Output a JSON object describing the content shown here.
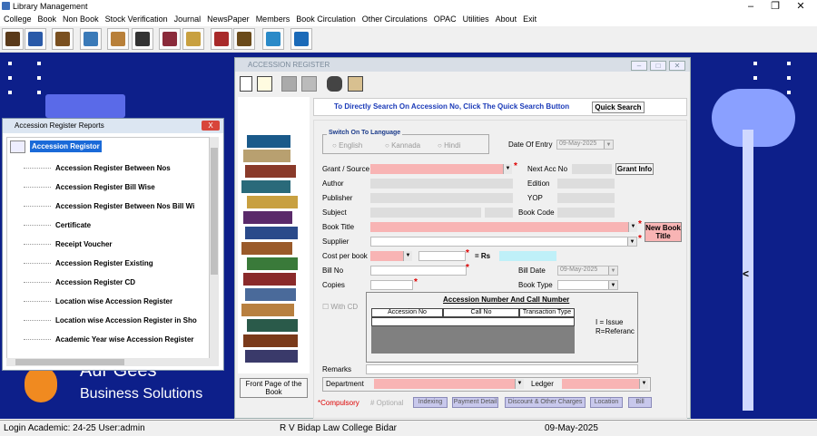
{
  "app_title": "Library Management",
  "menu": [
    "College",
    "Book",
    "Non Book",
    "Stock Verification",
    "Journal",
    "NewsPaper",
    "Members",
    "Book Circulation",
    "Other Circulations",
    "OPAC",
    "Utilities",
    "About",
    "Exit"
  ],
  "toolbar_icons": [
    "books-icon",
    "catalog-icon",
    "search-book-icon",
    "computer-icon",
    "member-icon",
    "id-card-icon",
    "journal-icon",
    "notes-icon",
    "circulation-icon",
    "library-icon",
    "transfer-icon",
    "help-icon"
  ],
  "reports": {
    "title": "Accession Register Reports",
    "close": "X",
    "root": "Accession Registor",
    "items": [
      "Accession Register Between Nos",
      "Accession Register Bill Wise",
      "Accession Register Between Nos Bill Wi",
      "Certificate",
      "Receipt Voucher",
      "Accession Register Existing",
      "Accession Register CD",
      "Location wise Accession Register",
      "Location wise Accession Register in Sho",
      "Academic Year wise Accession Register"
    ]
  },
  "branding": {
    "partial": "Aur Gees",
    "tagline": "Business Solutions"
  },
  "main": {
    "title": "ACCESSION REGISTER",
    "quick_search_text": "To Directly Search On Accession No, Click The Quick Search Button",
    "quick_search_btn": "Quick Search",
    "front_page_btn": "Front Page of the Book",
    "lang_group": "Switch On To Language",
    "langs": [
      "English",
      "Kannada",
      "Hindi"
    ],
    "date_of_entry_label": "Date Of Entry",
    "date_of_entry": "09-May-2025",
    "grant_label": "Grant / Source",
    "next_acc_label": "Next Acc No",
    "grant_info_btn": "Grant Info",
    "author_label": "Author",
    "edition_label": "Edition",
    "publisher_label": "Publisher",
    "yop_label": "YOP",
    "subject_label": "Subject",
    "book_code_label": "Book Code",
    "book_title_label": "Book Title",
    "new_book_btn": "New Book Title",
    "supplier_label": "Supplier",
    "cost_label": "Cost per book",
    "eq_rs": "=  Rs",
    "bill_no_label": "Bill No",
    "bill_date_label": "Bill Date",
    "bill_date": "09-May-2025",
    "copies_label": "Copies",
    "book_type_label": "Book Type",
    "with_cd": "With CD",
    "acc_group": "Accession Number And Call Number",
    "acc_cols": [
      "Accession No",
      "Call No",
      "Transaction Type"
    ],
    "legend1": "I = Issue",
    "legend2": "R=Referanc",
    "remarks_label": "Remarks",
    "department_label": "Department",
    "ledger_label": "Ledger",
    "compulsory": "*Compulsory",
    "optional": "#  Optional",
    "bottom_btns": [
      "Indexing",
      "Payment Detail",
      "Discount & Other Charges",
      "Location",
      "Bill"
    ],
    "side_arrow": "<"
  },
  "status": {
    "login": "Login Academic: 24-25  User:admin",
    "college": "R V Bidap Law College Bidar",
    "date": "09-May-2025"
  }
}
